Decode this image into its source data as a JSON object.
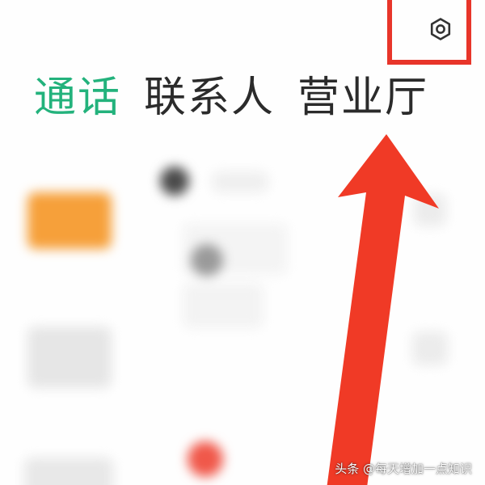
{
  "tabs": [
    {
      "label": "通话",
      "active": true
    },
    {
      "label": "联系人",
      "active": false
    },
    {
      "label": "营业厅",
      "active": false
    }
  ],
  "header": {
    "settings_icon": "settings-gear-icon"
  },
  "colors": {
    "active_tab": "#23b27c",
    "inactive_tab": "#2b2b2b",
    "annotation_red": "#e8352a",
    "orange_avatar": "#f5a23c",
    "red_dot": "#f0584a"
  },
  "watermark": {
    "text": "头条 @每天增加一点知识"
  }
}
